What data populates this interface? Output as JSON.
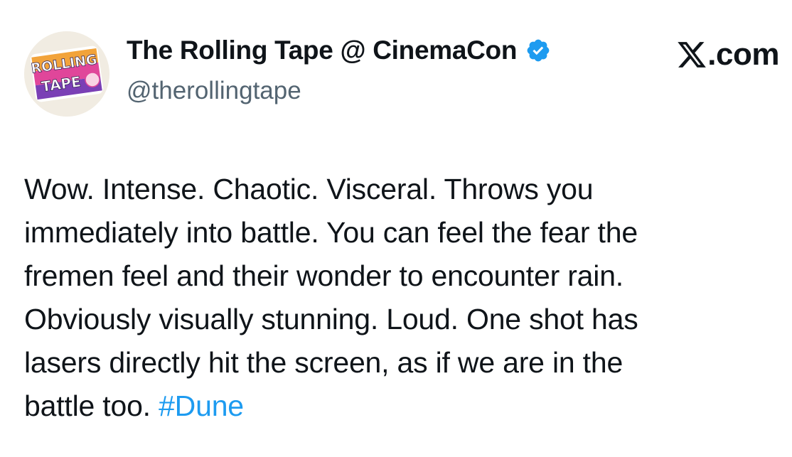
{
  "tweet": {
    "display_name": "The Rolling Tape @ CinemaCon",
    "handle": "@therollingtape",
    "verified": true,
    "brand": ".com",
    "brand_icon": "x-logo-icon",
    "avatar": {
      "icon": "rolling-tape-logo",
      "logo_text_line1": "ROLLING",
      "logo_text_line2": "TAPE"
    },
    "body_lines": [
      "Wow. Intense. Chaotic. Visceral. Throws you",
      "immediately into battle. You can feel the fear the",
      "fremen feel and their wonder to encounter rain.",
      "Obviously visually stunning. Loud. One shot has",
      "lasers directly hit the screen, as if we are in the"
    ],
    "last_line_text": "battle too. ",
    "hashtag": "#Dune"
  },
  "colors": {
    "text": "#0f1419",
    "secondary": "#536471",
    "link": "#1d9bf0",
    "verified": "#1d9bf0"
  }
}
